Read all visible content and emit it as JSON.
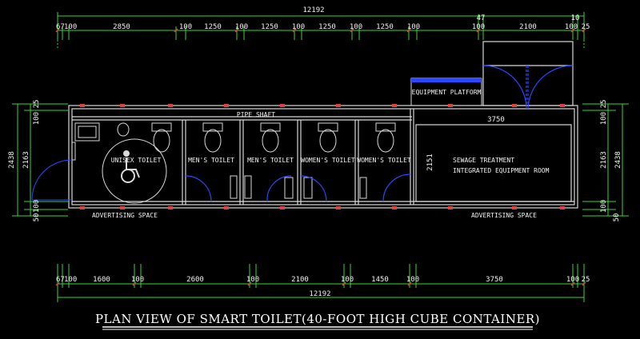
{
  "drawing": {
    "title": "PLAN VIEW OF SMART TOILET(40-FOOT HIGH CUBE CONTAINER)",
    "overall_length": "12192",
    "top_dims": [
      "67",
      "100",
      "2850",
      "100",
      "1250",
      "100",
      "1250",
      "100",
      "1250",
      "100",
      "1250",
      "100",
      "100",
      "2100",
      "100",
      "25"
    ],
    "top_small": "47",
    "top_small_right": "10",
    "bottom_dims": [
      "67",
      "100",
      "1600",
      "100",
      "2600",
      "100",
      "2100",
      "100",
      "1450",
      "100",
      "3750",
      "100",
      "25"
    ],
    "left_dims": [
      "25",
      "100",
      "2163",
      "2438",
      "100",
      "50"
    ],
    "right_dims": [
      "25",
      "100",
      "2163",
      "2438",
      "100",
      "50"
    ],
    "rooms": {
      "pipe_shaft": "PIPE SHAFT",
      "equipment_platform": "EQUIPMENT PLATFORM",
      "unisex": "UNISEX TOILET",
      "mens1": "MEN'S TOILET",
      "mens2": "MEN'S TOILET",
      "womens1": "WOMEN'S TOILET",
      "womens2": "WOMEN'S TOILET",
      "sewage1": "SEWAGE TREATMENT",
      "sewage2": "INTEGRATED EQUIPMENT ROOM",
      "dim_3750": "3750",
      "dim_2151": "2151"
    },
    "advertising_left": "ADVERTISING SPACE",
    "advertising_right": "ADVERTISING SPACE"
  },
  "colors": {
    "wall": "#d9d9d9",
    "dimension": "#39d639",
    "door": "#2a49ff",
    "accent": "#e04040",
    "title": "#ffffff"
  }
}
